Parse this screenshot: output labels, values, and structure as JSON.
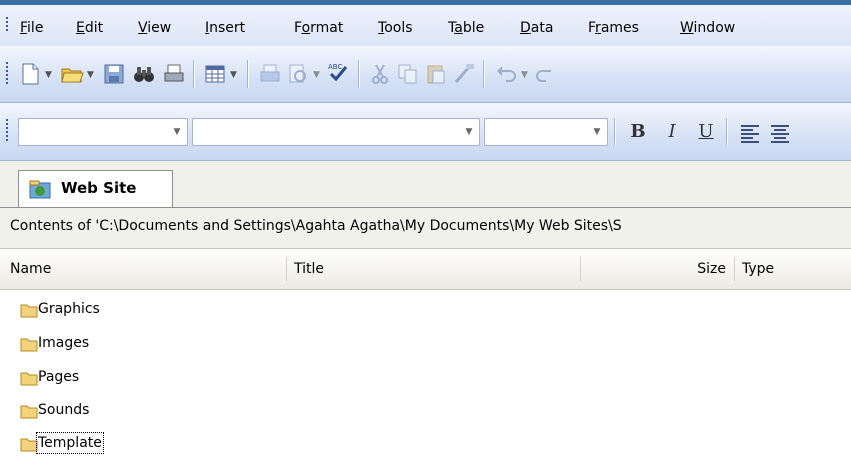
{
  "menubar": {
    "items": [
      {
        "accel": "F",
        "rest": "ile"
      },
      {
        "accel": "E",
        "rest": "dit"
      },
      {
        "accel": "V",
        "rest": "iew"
      },
      {
        "accel": "I",
        "rest": "nsert"
      },
      {
        "pre": "F",
        "accel": "o",
        "rest": "rmat"
      },
      {
        "accel": "T",
        "rest": "ools"
      },
      {
        "pre": "T",
        "accel": "a",
        "rest": "ble"
      },
      {
        "accel": "D",
        "rest": "ata"
      },
      {
        "pre": "F",
        "accel": "r",
        "rest": "ames"
      },
      {
        "accel": "W",
        "rest": "indow"
      }
    ]
  },
  "format_toolbar": {
    "bold": "B",
    "italic": "I",
    "underline": "U"
  },
  "tab": {
    "label": "Web Site"
  },
  "path": {
    "text": "Contents of 'C:\\Documents and Settings\\Agahta Agatha\\My Documents\\My Web Sites\\S"
  },
  "columns": {
    "name": "Name",
    "title": "Title",
    "size": "Size",
    "type": "Type"
  },
  "rows": [
    {
      "name": "Graphics"
    },
    {
      "name": "Images"
    },
    {
      "name": "Pages"
    },
    {
      "name": "Sounds"
    },
    {
      "name": "Template"
    }
  ],
  "colors": {
    "accent": "#3a6ea5",
    "folder": "#f2d27a"
  }
}
